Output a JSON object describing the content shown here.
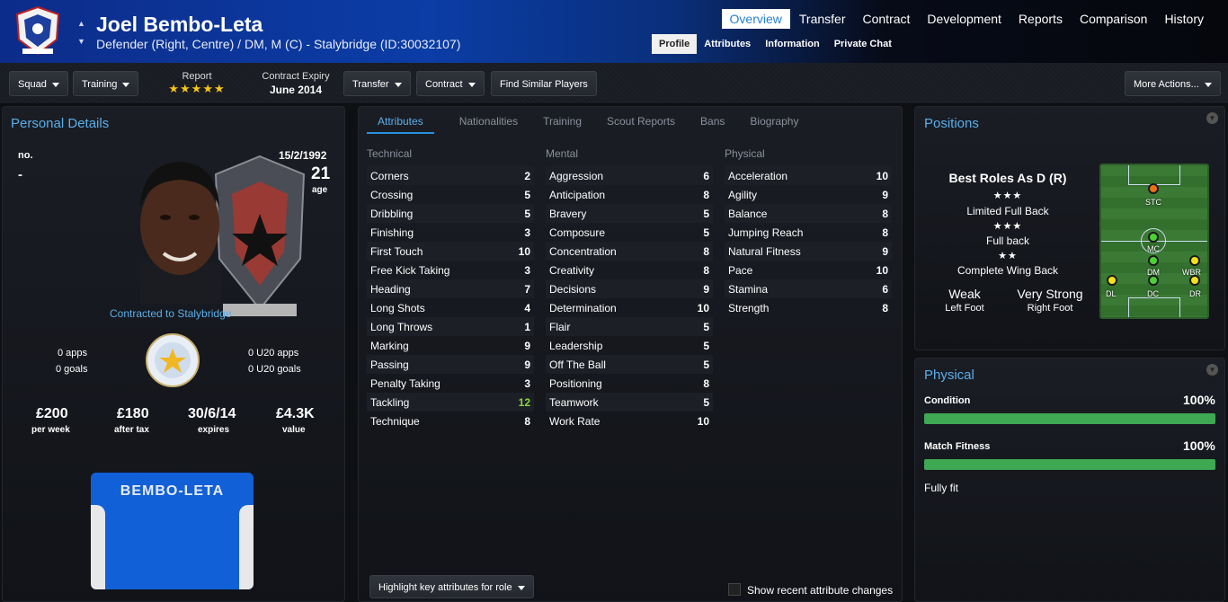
{
  "header": {
    "player_name": "Joel Bembo-Leta",
    "description": "Defender (Right, Centre) / DM, M (C) - Stalybridge (ID:30032107)",
    "main_nav": [
      "Overview",
      "Transfer",
      "Contract",
      "Development",
      "Reports",
      "Comparison",
      "History"
    ],
    "sub_nav": [
      "Profile",
      "Attributes",
      "Information",
      "Private Chat"
    ]
  },
  "toolbar": {
    "squad": "Squad",
    "training": "Training",
    "report_label": "Report",
    "report_stars": "★★★★★",
    "contract_label": "Contract Expiry",
    "contract_value": "June 2014",
    "transfer": "Transfer",
    "contract": "Contract",
    "find_similar": "Find Similar Players",
    "more_actions": "More Actions..."
  },
  "personal": {
    "title": "Personal Details",
    "no_label": "no.",
    "no_value": "-",
    "dob": "15/2/1992",
    "age": "21",
    "age_label": "age",
    "contracted": "Contracted to Stalybridge",
    "apps": "0 apps",
    "goals": "0 goals",
    "u20_apps": "0 U20 apps",
    "u20_goals": "0 U20 goals",
    "wage": "£200",
    "wage_label": "per week",
    "after_tax": "£180",
    "after_tax_label": "after tax",
    "expires": "30/6/14",
    "expires_label": "expires",
    "value": "£4.3K",
    "value_label": "value",
    "shirt_name": "BEMBO-LETA"
  },
  "attr_tabs": [
    "Attributes",
    "Nationalities",
    "Training",
    "Scout Reports",
    "Bans",
    "Biography"
  ],
  "technical": {
    "label": "Technical",
    "rows": [
      {
        "name": "Corners",
        "value": "2"
      },
      {
        "name": "Crossing",
        "value": "5"
      },
      {
        "name": "Dribbling",
        "value": "5"
      },
      {
        "name": "Finishing",
        "value": "3"
      },
      {
        "name": "First Touch",
        "value": "10"
      },
      {
        "name": "Free Kick Taking",
        "value": "3"
      },
      {
        "name": "Heading",
        "value": "7"
      },
      {
        "name": "Long Shots",
        "value": "4"
      },
      {
        "name": "Long Throws",
        "value": "1"
      },
      {
        "name": "Marking",
        "value": "9"
      },
      {
        "name": "Passing",
        "value": "9"
      },
      {
        "name": "Penalty Taking",
        "value": "3"
      },
      {
        "name": "Tackling",
        "value": "12"
      },
      {
        "name": "Technique",
        "value": "8"
      }
    ]
  },
  "mental": {
    "label": "Mental",
    "rows": [
      {
        "name": "Aggression",
        "value": "6"
      },
      {
        "name": "Anticipation",
        "value": "8"
      },
      {
        "name": "Bravery",
        "value": "5"
      },
      {
        "name": "Composure",
        "value": "5"
      },
      {
        "name": "Concentration",
        "value": "8"
      },
      {
        "name": "Creativity",
        "value": "8"
      },
      {
        "name": "Decisions",
        "value": "9"
      },
      {
        "name": "Determination",
        "value": "10"
      },
      {
        "name": "Flair",
        "value": "5"
      },
      {
        "name": "Leadership",
        "value": "5"
      },
      {
        "name": "Off The Ball",
        "value": "5"
      },
      {
        "name": "Positioning",
        "value": "8"
      },
      {
        "name": "Teamwork",
        "value": "5"
      },
      {
        "name": "Work Rate",
        "value": "10"
      }
    ]
  },
  "physical_attrs": {
    "label": "Physical",
    "rows": [
      {
        "name": "Acceleration",
        "value": "10"
      },
      {
        "name": "Agility",
        "value": "9"
      },
      {
        "name": "Balance",
        "value": "8"
      },
      {
        "name": "Jumping Reach",
        "value": "8"
      },
      {
        "name": "Natural Fitness",
        "value": "9"
      },
      {
        "name": "Pace",
        "value": "10"
      },
      {
        "name": "Stamina",
        "value": "6"
      },
      {
        "name": "Strength",
        "value": "8"
      }
    ]
  },
  "attr_footer": {
    "highlight": "Highlight key attributes for role",
    "show_recent": "Show recent attribute changes"
  },
  "positions": {
    "title": "Positions",
    "best_roles": "Best Roles As D (R)",
    "role1": "Limited Full Back",
    "role1_stars": "★★★",
    "role2": "Full back",
    "role2_stars": "★★★",
    "role3": "Complete Wing Back",
    "role3_stars": "★★",
    "weak": "Weak",
    "left_foot": "Left Foot",
    "very_strong": "Very Strong",
    "right_foot": "Right Foot",
    "pitch_labels": [
      "STC",
      "MC",
      "DM",
      "WBR",
      "DL",
      "DC",
      "DR"
    ],
    "colors": {
      "natural": "#f5e11a",
      "accomplished": "#4cd137",
      "unconvincing": "#e8701a"
    }
  },
  "physical": {
    "title": "Physical",
    "condition_label": "Condition",
    "condition_value": "100%",
    "condition_fraction": 1.0,
    "fitness_label": "Match Fitness",
    "fitness_value": "100%",
    "fitness_fraction": 1.0,
    "status": "Fully fit"
  }
}
